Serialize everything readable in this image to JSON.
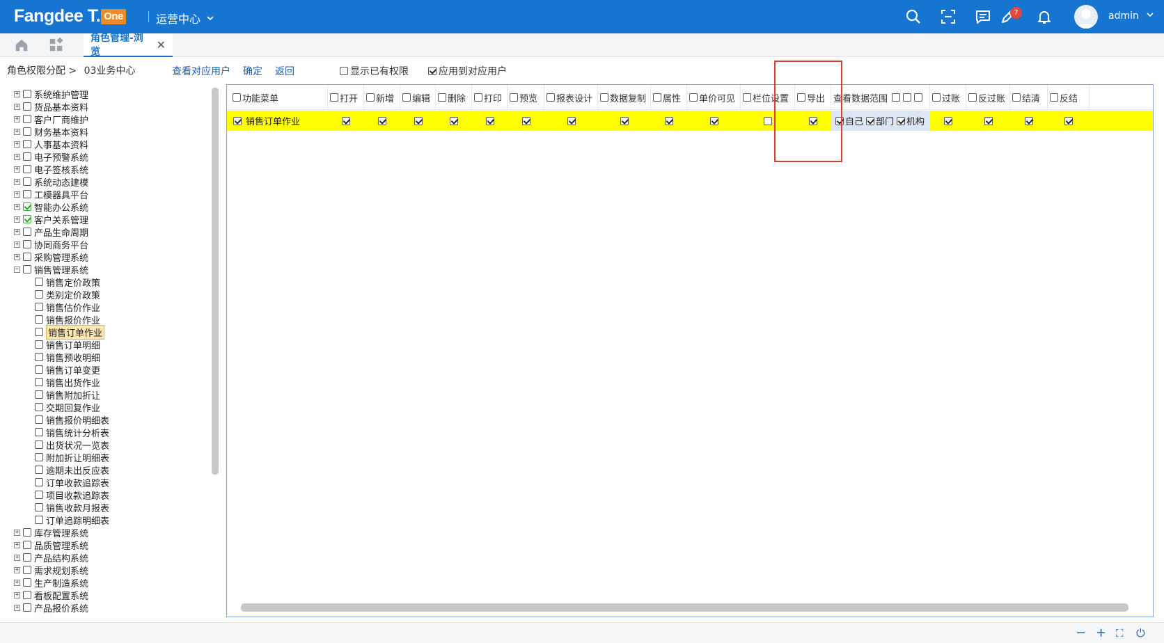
{
  "app": {
    "logo_text": "Fangdee T.",
    "logo_badge": "One",
    "center": "运营中心",
    "notification_count": "7",
    "user": "admin"
  },
  "icons": {
    "search": "search-icon",
    "scan": "scan-icon",
    "message": "message-icon",
    "edit": "edit-icon",
    "bell": "bell-icon",
    "home": "home-icon",
    "apps": "apps-icon"
  },
  "tabs": [
    {
      "label": "角色管理-浏览",
      "active": true
    }
  ],
  "toolbar": {
    "breadcrumb": "角色权限分配 >",
    "breadcrumb_current": "03业务中心",
    "view_users": "查看对应用户",
    "confirm": "确定",
    "back": "返回",
    "show_existing": "显示已有权限",
    "apply_users": "应用到对应用户",
    "show_existing_checked": false,
    "apply_users_checked": true
  },
  "tree": [
    {
      "label": "系统维护管理",
      "level": 0,
      "expandable": true,
      "checked": false
    },
    {
      "label": "货品基本资料",
      "level": 0,
      "expandable": true,
      "checked": false
    },
    {
      "label": "客户厂商维护",
      "level": 0,
      "expandable": true,
      "checked": false
    },
    {
      "label": "财务基本资料",
      "level": 0,
      "expandable": true,
      "checked": false
    },
    {
      "label": "人事基本资料",
      "level": 0,
      "expandable": true,
      "checked": false
    },
    {
      "label": "电子预警系统",
      "level": 0,
      "expandable": true,
      "checked": false
    },
    {
      "label": "电子签核系统",
      "level": 0,
      "expandable": true,
      "checked": false
    },
    {
      "label": "系统动态建模",
      "level": 0,
      "expandable": true,
      "checked": false
    },
    {
      "label": "工模器具平台",
      "level": 0,
      "expandable": true,
      "checked": false
    },
    {
      "label": "智能办公系统",
      "level": 0,
      "expandable": true,
      "checked": true
    },
    {
      "label": "客户关系管理",
      "level": 0,
      "expandable": true,
      "checked": true
    },
    {
      "label": "产品生命周期",
      "level": 0,
      "expandable": true,
      "checked": false
    },
    {
      "label": "协同商务平台",
      "level": 0,
      "expandable": true,
      "checked": false
    },
    {
      "label": "采购管理系统",
      "level": 0,
      "expandable": true,
      "checked": false
    },
    {
      "label": "销售管理系统",
      "level": 0,
      "expandable": true,
      "expanded": true,
      "checked": false
    },
    {
      "label": "销售定价政策",
      "level": 1,
      "checked": false
    },
    {
      "label": "类别定价政策",
      "level": 1,
      "checked": false
    },
    {
      "label": "销售估价作业",
      "level": 1,
      "checked": false
    },
    {
      "label": "销售报价作业",
      "level": 1,
      "checked": false
    },
    {
      "label": "销售订单作业",
      "level": 1,
      "checked": false,
      "selected": true
    },
    {
      "label": "销售订单明细",
      "level": 1,
      "checked": false
    },
    {
      "label": "销售预收明细",
      "level": 1,
      "checked": false
    },
    {
      "label": "销售订单变更",
      "level": 1,
      "checked": false
    },
    {
      "label": "销售出货作业",
      "level": 1,
      "checked": false
    },
    {
      "label": "销售附加折让",
      "level": 1,
      "checked": false
    },
    {
      "label": "交期回复作业",
      "level": 1,
      "checked": false
    },
    {
      "label": "销售报价明细表",
      "level": 1,
      "checked": false
    },
    {
      "label": "销售统计分析表",
      "level": 1,
      "checked": false
    },
    {
      "label": "出货状况一览表",
      "level": 1,
      "checked": false
    },
    {
      "label": "附加折让明细表",
      "level": 1,
      "checked": false
    },
    {
      "label": "逾期未出反应表",
      "level": 1,
      "checked": false
    },
    {
      "label": "订单收款追踪表",
      "level": 1,
      "checked": false
    },
    {
      "label": "项目收款追踪表",
      "level": 1,
      "checked": false
    },
    {
      "label": "销售收款月报表",
      "level": 1,
      "checked": false
    },
    {
      "label": "订单追踪明细表",
      "level": 1,
      "checked": false
    },
    {
      "label": "库存管理系统",
      "level": 0,
      "expandable": true,
      "checked": false
    },
    {
      "label": "品质管理系统",
      "level": 0,
      "expandable": true,
      "checked": false
    },
    {
      "label": "产品结构系统",
      "level": 0,
      "expandable": true,
      "checked": false
    },
    {
      "label": "需求规划系统",
      "level": 0,
      "expandable": true,
      "checked": false
    },
    {
      "label": "生产制造系统",
      "level": 0,
      "expandable": true,
      "checked": false
    },
    {
      "label": "看板配置系统",
      "level": 0,
      "expandable": true,
      "checked": false
    },
    {
      "label": "产品报价系统",
      "level": 0,
      "expandable": true,
      "checked": false
    }
  ],
  "grid": {
    "columns": [
      {
        "label": "功能菜单"
      },
      {
        "label": "打开"
      },
      {
        "label": "新增"
      },
      {
        "label": "编辑"
      },
      {
        "label": "删除"
      },
      {
        "label": "打印"
      },
      {
        "label": "预览"
      },
      {
        "label": "报表设计"
      },
      {
        "label": "数据复制"
      },
      {
        "label": "属性"
      },
      {
        "label": "单价可见"
      },
      {
        "label": "栏位设置"
      },
      {
        "label": "导出"
      },
      {
        "label": "查看数据范围"
      },
      {
        "label": "过账"
      },
      {
        "label": "反过账"
      },
      {
        "label": "结清"
      },
      {
        "label": "反结"
      }
    ],
    "row": {
      "menu": "销售订单作业",
      "values": [
        true,
        true,
        true,
        true,
        true,
        true,
        true,
        true,
        true,
        true,
        false,
        true,
        null,
        true,
        true,
        true,
        true
      ],
      "scope": [
        {
          "label": "自己",
          "checked": true
        },
        {
          "label": "部门",
          "checked": true
        },
        {
          "label": "机构",
          "checked": true
        }
      ]
    }
  },
  "footer": {
    "icons": [
      "minus-icon",
      "plus-icon",
      "fullscreen-icon",
      "power-icon"
    ]
  }
}
